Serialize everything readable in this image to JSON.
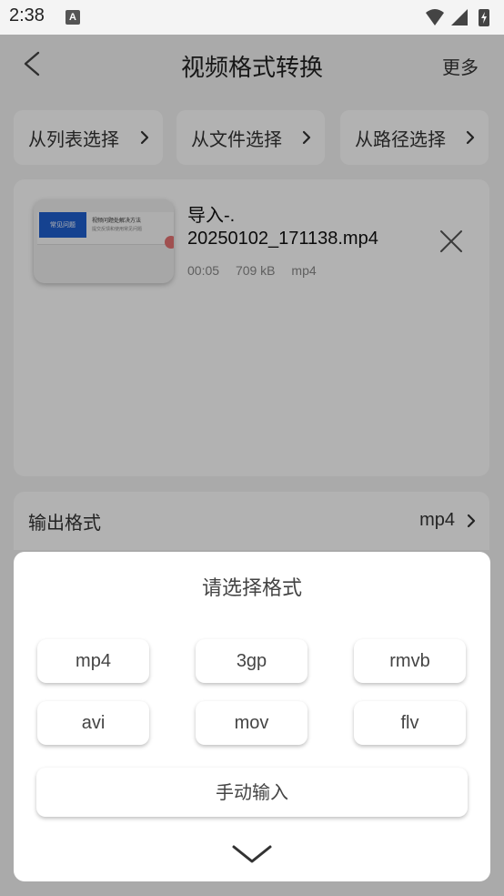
{
  "status_bar": {
    "time": "2:38",
    "notification_letter": "A"
  },
  "app_bar": {
    "title": "视频格式转换",
    "more_label": "更多"
  },
  "sources": [
    {
      "label": "从列表选择"
    },
    {
      "label": "从文件选择"
    },
    {
      "label": "从路径选择"
    }
  ],
  "file": {
    "name": "导入-.\n20250102_171138.mp4",
    "duration": "00:05",
    "size": "709 kB",
    "format": "mp4",
    "thumbnail": {
      "banner": "常见问题",
      "line1": "视频问题处解决方法",
      "line2": "提交反馈和使用常见问题"
    }
  },
  "output": {
    "label": "输出格式",
    "value": "mp4"
  },
  "sheet": {
    "title": "请选择格式",
    "formats": [
      "mp4",
      "3gp",
      "rmvb",
      "avi",
      "mov",
      "flv"
    ],
    "manual_label": "手动输入"
  },
  "colors": {
    "background": "#f4f4f4",
    "surface": "#ffffff",
    "scrim": "rgba(0,0,0,0.30)",
    "thumb_accent": "#1f5fcf"
  }
}
